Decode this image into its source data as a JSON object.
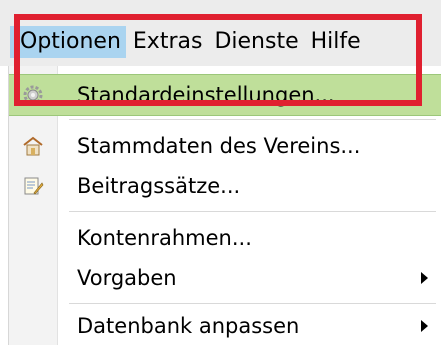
{
  "menubar": {
    "titles": [
      "Optionen",
      "Extras",
      "Dienste",
      "Hilfe"
    ],
    "active_index": 0
  },
  "menu": {
    "items": [
      {
        "label": "Standardeinstellungen...",
        "icon": "gear-icon",
        "highlighted": true,
        "submenu": false
      },
      {
        "label": "Stammdaten des Vereins...",
        "icon": "clubhouse-icon",
        "highlighted": false,
        "submenu": false
      },
      {
        "label": "Beitragssätze...",
        "icon": "edit-document-icon",
        "highlighted": false,
        "submenu": false
      },
      {
        "label": "Kontenrahmen...",
        "icon": "",
        "highlighted": false,
        "submenu": false
      },
      {
        "label": "Vorgaben",
        "icon": "",
        "highlighted": false,
        "submenu": true
      },
      {
        "label": "Datenbank anpassen",
        "icon": "",
        "highlighted": false,
        "submenu": true
      }
    ]
  },
  "colors": {
    "highlight": "#bfdf9a",
    "active_menu_title": "#aad4f0",
    "annotation_frame": "#e02030"
  }
}
